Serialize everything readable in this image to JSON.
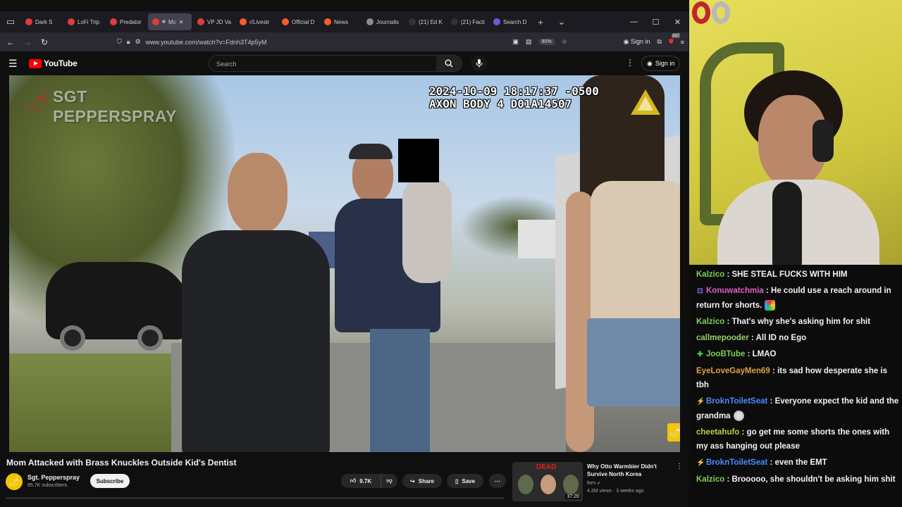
{
  "browser": {
    "tabs": [
      {
        "label": "Dark S",
        "color": "#e33b3b"
      },
      {
        "label": "LoFi Trip",
        "color": "#e33b3b"
      },
      {
        "label": "Predator",
        "color": "#e33b3b"
      },
      {
        "label": "Mc",
        "color": "#e33b3b",
        "active": true
      },
      {
        "label": "VP JD Va",
        "color": "#e33b3b"
      },
      {
        "label": "r/Livestr",
        "color": "#ff5a2a"
      },
      {
        "label": "Official D",
        "color": "#ff5a2a"
      },
      {
        "label": "News",
        "color": "#ff5a2a"
      },
      {
        "label": "Journalis",
        "color": "#8a8a8a"
      },
      {
        "label": "(21) Ed K",
        "color": "#333333"
      },
      {
        "label": "(21) Facti",
        "color": "#333333"
      },
      {
        "label": "Search D",
        "color": "#6b5bd6"
      }
    ],
    "new_tab": "+",
    "tab_list": "⌄",
    "win_min": "—",
    "win_max": "☐",
    "win_close": "✕",
    "url": "www.youtube.com/watch?v=Fdnh3T4p5yM",
    "zoom": "90%",
    "sign_in": "Sign in",
    "notif_count": "237"
  },
  "youtube": {
    "logo_text": "YouTube",
    "search_placeholder": "Search",
    "sign_in": "Sign in"
  },
  "video": {
    "overlay_channel_line1": "SGT",
    "overlay_channel_line2": "PEPPERSPRAY",
    "timestamp_line1": "2024-10-09 18:17:37 -0500",
    "timestamp_line2": "AXON BODY 4 D01A14507",
    "title": "Mom Attacked with Brass Knuckles Outside Kid's Dentist",
    "channel_name": "Sgt. Pepperspray",
    "subscribers": "85.7K subscribers",
    "subscribe_label": "Subscribe",
    "like_count": "9.7K",
    "share_label": "Share",
    "save_label": "Save"
  },
  "recommended": {
    "thumb_text": "DEAD",
    "duration": "37:20",
    "title": "Why Otto Warmbier Didn't Survive North Korea",
    "channel": "fern",
    "meta": "4.2M views · 3 weeks ago"
  },
  "chat": [
    {
      "user": "Kalzico",
      "color": "#7bd15a",
      "badge": "",
      "text": "SHE STEAL FUCKS WITH HIM"
    },
    {
      "user": "Konuwatchmia",
      "color": "#e05cc4",
      "badge": "⊡",
      "badge_color": "#8a7bff",
      "text": "He could use a reach around in return for shorts.",
      "emote": "rainbow"
    },
    {
      "user": "Kalzico",
      "color": "#7bd15a",
      "badge": "",
      "text": "That's why she's asking him for shit"
    },
    {
      "user": "callmepooder",
      "color": "#9ad06a",
      "badge": "",
      "text": "All ID no Ego"
    },
    {
      "user": "JooBTube",
      "color": "#7bd15a",
      "badge": "✚",
      "badge_color": "#3ed15a",
      "text": "LMAO"
    },
    {
      "user": "EyeLoveGayMen69",
      "color": "#e0a040",
      "badge": "",
      "text": "its sad how desperate she is tbh"
    },
    {
      "user": "BroknToiletSeat",
      "color": "#4a8cff",
      "badge": "⚡",
      "badge_color": "#e0b040",
      "text": "Everyone expect the kid and the grandma",
      "emote": "skull"
    },
    {
      "user": "cheetahufo",
      "color": "#c4c93c",
      "badge": "",
      "text": "go get me some shorts the ones with my ass hanging out please"
    },
    {
      "user": "BroknToiletSeat",
      "color": "#4a8cff",
      "badge": "⚡",
      "badge_color": "#e0b040",
      "text": "even the EMT"
    },
    {
      "user": "Kalzico",
      "color": "#7bd15a",
      "badge": "",
      "text": "Brooooo, she shouldn't be asking him shit"
    }
  ]
}
